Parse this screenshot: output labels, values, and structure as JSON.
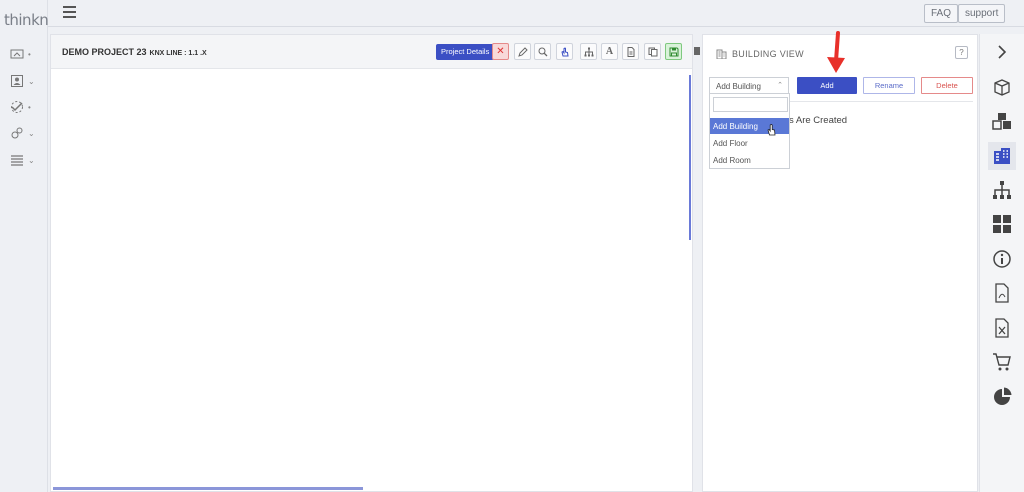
{
  "app": {
    "logo_text": "thinknx"
  },
  "topbar": {
    "faq_label": "FAQ",
    "support_label": "support"
  },
  "editor": {
    "project_name": "DEMO PROJECT 23",
    "project_version": "KNX LINE : 1.1 .X",
    "details_label": "Project Details",
    "tools": [
      "close-icon",
      "pencil-icon",
      "search-icon",
      "hand-icon",
      "hierarchy-icon",
      "text-icon",
      "document-icon",
      "copy-icon",
      "save-icon"
    ]
  },
  "building_view": {
    "title": "BUILDING VIEW",
    "help_label": "?",
    "select_value": "Add Building",
    "add_label": "Add",
    "rename_label": "Rename",
    "delete_label": "Delete",
    "empty_message": "s Are Created",
    "dropdown_options": [
      "Add Building",
      "Add Floor",
      "Add Room"
    ],
    "selected_option_index": 0
  },
  "rail": {
    "items": [
      "chevron-right-icon",
      "cube-icon",
      "cubes-icon",
      "building-icon",
      "hierarchy-icon",
      "grid-icon",
      "info-icon",
      "pdf-icon",
      "excel-icon",
      "cart-icon",
      "pie-chart-icon"
    ],
    "active_index": 3
  },
  "colors": {
    "primary": "#3b4fc4",
    "danger": "#d9534f",
    "dropdown_highlight": "#5a78d6",
    "arrow": "#e8302a"
  }
}
